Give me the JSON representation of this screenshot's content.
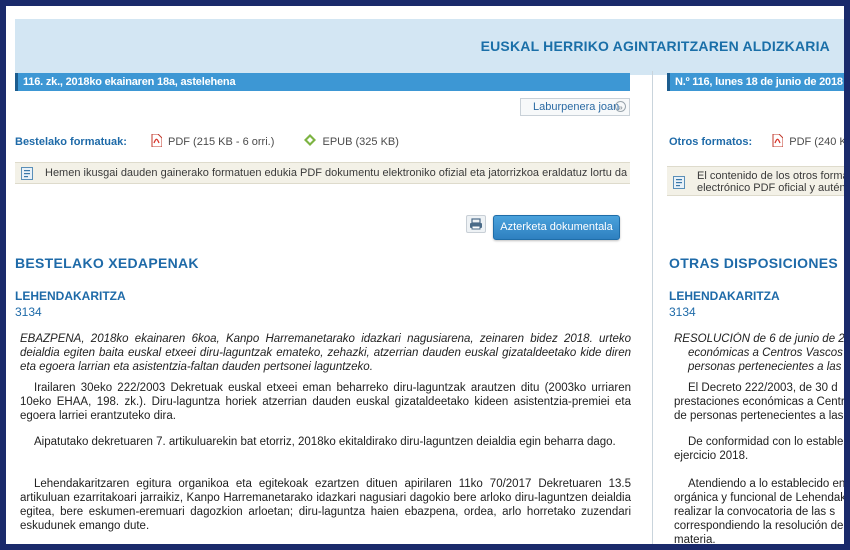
{
  "header": {
    "title": "EUSKAL HERRIKO AGINTARITZAREN ALDIZKARIA"
  },
  "left": {
    "datebar": "116. zk., 2018ko ekainaren 18a, astelehena",
    "jump_button": "Laburpenera joan",
    "formats_label": "Bestelako formatuak:",
    "pdf_label": "PDF (215 KB - 6 orri.)",
    "epub_label": "EPUB (325 KB)",
    "note": "Hemen ikusgai dauden gainerako formatuen edukia PDF dokumentu elektroniko ofizial eta jatorrizkoa eraldatuz lortu da",
    "exam_button": "Azterketa dokumentala",
    "section_title": "BESTELAKO XEDAPENAK",
    "department": "LEHENDAKARITZA",
    "doc_number": "3134",
    "paragraphs": [
      "EBAZPENA, 2018ko ekainaren 6koa, Kanpo Harremanetarako idazkari nagusiarena, zeinaren bidez 2018. urteko deialdia egiten baita euskal etxeei diru-laguntzak emateko, zehazki, atzerrian dauden euskal gizataldeetako kide diren eta egoera larrian eta asistentzia-faltan dauden pertsonei laguntzeko.",
      "Irailaren 30eko 222/2003 Dekretuak euskal etxeei eman beharreko diru-laguntzak arautzen ditu (2003ko urriaren 10eko EHAA, 198. zk.). Diru-laguntza horiek atzerrian dauden euskal gizataldeetako kideen asistentzia-premiei eta egoera larriei erantzuteko dira.",
      "Aipatutako dekretuaren 7. artikuluarekin bat etorriz, 2018ko ekitaldirako diru-laguntzen deialdia egin beharra dago.",
      "Lehendakaritzaren egitura organikoa eta egitekoak ezartzen dituen apirilaren 11ko 70/2017 Dekretuaren 13.5 artikuluan ezarritakoari jarraikiz, Kanpo Harremanetarako idazkari nagusiari dagokio bere arloko diru-laguntzen deialdia egitea, bere eskumen-eremuari dagozkion arloetan; diru-laguntza haien ebazpena, ordea, arlo horretako zuzendari eskudunek emango dute."
    ]
  },
  "right": {
    "datebar": "N.º 116, lunes 18 de junio de 2018",
    "formats_label": "Otros formatos:",
    "pdf_label": "PDF (240 K",
    "note_line1": "El contenido de los otros format",
    "note_line2": "electrónico PDF oficial y autént",
    "section_title": "OTRAS DISPOSICIONES",
    "department": "LEHENDAKARITZA",
    "doc_number": "3134",
    "p1": [
      "RESOLUCIÓN de 6 de junio de 2",
      "económicas a Centros Vascos",
      "personas pertenecientes a las Co"
    ],
    "p2": [
      "El Decreto 222/2003, de 30 d",
      "prestaciones económicas a Centro",
      "de personas pertenecientes a las C"
    ],
    "p3": [
      "De conformidad con lo estable",
      "ejercicio 2018."
    ],
    "p4": [
      "Atendiendo a lo establecido en e",
      "orgánica y funcional de Lehendak",
      "realizar la convocatoria de las s",
      "correspondiendo la resolución de",
      "materia."
    ]
  },
  "colors": {
    "accent": "#1e6aa8",
    "datebar": "#3d97d4",
    "header_band": "#d3e6f3",
    "border": "#1a2a6b"
  },
  "icons": [
    "pdf-icon",
    "epub-icon",
    "info-icon",
    "print-icon",
    "arrow-circle-icon"
  ]
}
